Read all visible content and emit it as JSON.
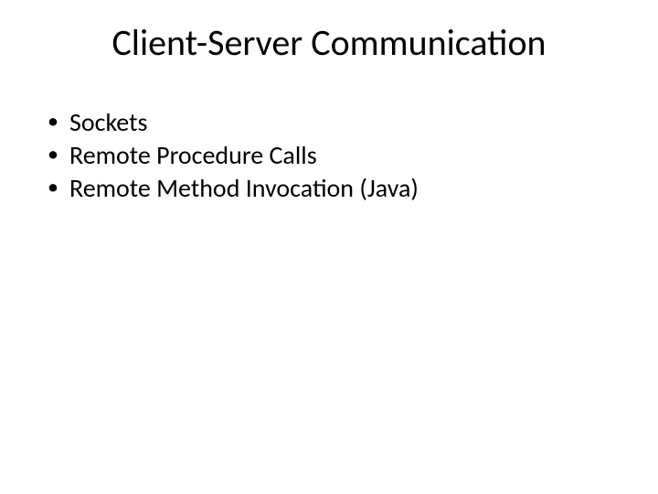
{
  "slide": {
    "title": "Client-Server Communication",
    "bullets": [
      "Sockets",
      "Remote Procedure Calls",
      "Remote Method Invocation (Java)"
    ]
  }
}
